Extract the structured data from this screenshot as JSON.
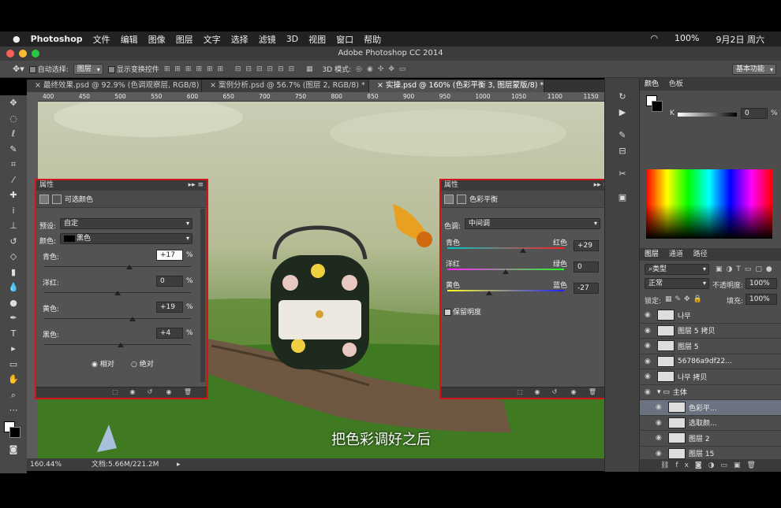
{
  "menubar": {
    "app": "Photoshop",
    "items": [
      "文件",
      "编辑",
      "图像",
      "图层",
      "文字",
      "选择",
      "滤镜",
      "3D",
      "视图",
      "窗口",
      "帮助"
    ],
    "battery": "100%",
    "date": "9月2日 周六"
  },
  "window": {
    "title": "Adobe Photoshop CC 2014"
  },
  "options": {
    "auto_select_label": "自动选择:",
    "auto_select_value": "图层",
    "show_transform_label": "显示变换控件",
    "mode3d_label": "3D 模式:",
    "workspace": "基本功能"
  },
  "tabs": [
    {
      "label": "最终效果.psd @ 92.9% (色调观察层, RGB/8) *"
    },
    {
      "label": "案例分析.psd @ 56.7% (图层 2, RGB/8) *"
    },
    {
      "label": "实操.psd @ 160% (色彩平衡 3, 图层蒙版/8) *"
    }
  ],
  "ruler": [
    "400",
    "450",
    "500",
    "550",
    "600",
    "650",
    "700",
    "750",
    "800",
    "850",
    "900",
    "950",
    "1000",
    "1050",
    "1100",
    "1150"
  ],
  "status": {
    "zoom": "160.44%",
    "doc": "文档:5.66M/221.2M"
  },
  "subtitle": "把色彩调好之后",
  "selective": {
    "panel_title": "属性",
    "type_label": "可选颜色",
    "preset_label": "预设:",
    "preset_value": "自定",
    "color_label": "颜色:",
    "color_value": "黑色",
    "rows": [
      {
        "label": "青色:",
        "value": "+17",
        "unit": "%",
        "pos": 0.58
      },
      {
        "label": "洋红:",
        "value": "0",
        "unit": "%",
        "pos": 0.5
      },
      {
        "label": "黄色:",
        "value": "+19",
        "unit": "%",
        "pos": 0.6
      },
      {
        "label": "黑色:",
        "value": "+4",
        "unit": "%",
        "pos": 0.52
      }
    ],
    "relative": "相对",
    "absolute": "绝对"
  },
  "balance": {
    "panel_title": "属性",
    "type_label": "色彩平衡",
    "tone_label": "色调:",
    "tone_value": "中间调",
    "rows": [
      {
        "left": "青色",
        "right": "红色",
        "value": "+29",
        "pos": 0.65,
        "grad": "linear-gradient(90deg,#00c8c8,#ff2020)"
      },
      {
        "left": "洋红",
        "right": "绿色",
        "value": "0",
        "pos": 0.5,
        "grad": "linear-gradient(90deg,#ff20ff,#20ff20)"
      },
      {
        "left": "黄色",
        "right": "蓝色",
        "value": "-27",
        "pos": 0.36,
        "grad": "linear-gradient(90deg,#ffff20,#2020ff)"
      }
    ],
    "preserve": "保留明度"
  },
  "color_panel": {
    "tabs": [
      "颜色",
      "色板"
    ],
    "channel": "K",
    "value": "0",
    "unit": "%"
  },
  "layers_panel": {
    "tabs": [
      "图层",
      "通道",
      "路径"
    ],
    "filter": "类型",
    "blend": "正常",
    "opacity_label": "不透明度:",
    "opacity": "100%",
    "lock_label": "锁定:",
    "fill_label": "填充:",
    "fill": "100%",
    "layers": [
      {
        "name": "나무",
        "indent": 0
      },
      {
        "name": "图层 5 拷贝",
        "indent": 0
      },
      {
        "name": "图层 5",
        "indent": 0
      },
      {
        "name": "56786a9df22...",
        "indent": 0
      },
      {
        "name": "나무 拷贝",
        "indent": 0
      },
      {
        "name": "主体",
        "indent": 0,
        "group": true
      },
      {
        "name": "色彩平...",
        "indent": 1,
        "selected": true
      },
      {
        "name": "选取颜...",
        "indent": 1
      },
      {
        "name": "图层 2",
        "indent": 1
      },
      {
        "name": "图层 15",
        "indent": 1
      }
    ]
  }
}
